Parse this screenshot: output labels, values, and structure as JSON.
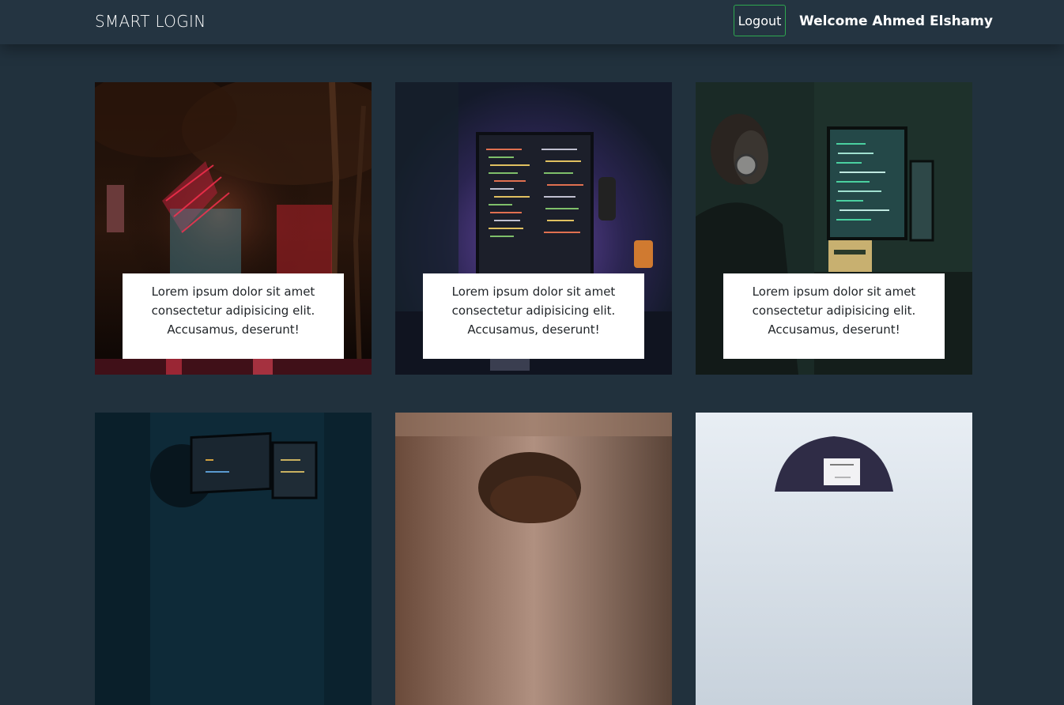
{
  "navbar": {
    "brand": "SMART LOGIN",
    "logout_label": "Logout",
    "welcome": "Welcome Ahmed Elshamy"
  },
  "cards": [
    {
      "caption": "Lorem ipsum dolor sit amet consectetur adipisicing elit. Accusamus, deserunt!",
      "image": "night-street-neon-photo"
    },
    {
      "caption": "Lorem ipsum dolor sit amet consectetur adipisicing elit. Accusamus, deserunt!",
      "image": "code-monitor-purple-light-photo"
    },
    {
      "caption": "Lorem ipsum dolor sit amet consectetur adipisicing elit. Accusamus, deserunt!",
      "image": "developer-headphones-monitors-photo"
    },
    {
      "caption": "",
      "image": "laptops-dark-office-photo"
    },
    {
      "caption": "",
      "image": "person-hair-closeup-photo"
    },
    {
      "caption": "",
      "image": "person-cap-photo"
    }
  ],
  "colors": {
    "background": "#21313d",
    "navbar": "#243441",
    "logout_border": "#2fa84f",
    "caption_bg": "#ffffff"
  }
}
